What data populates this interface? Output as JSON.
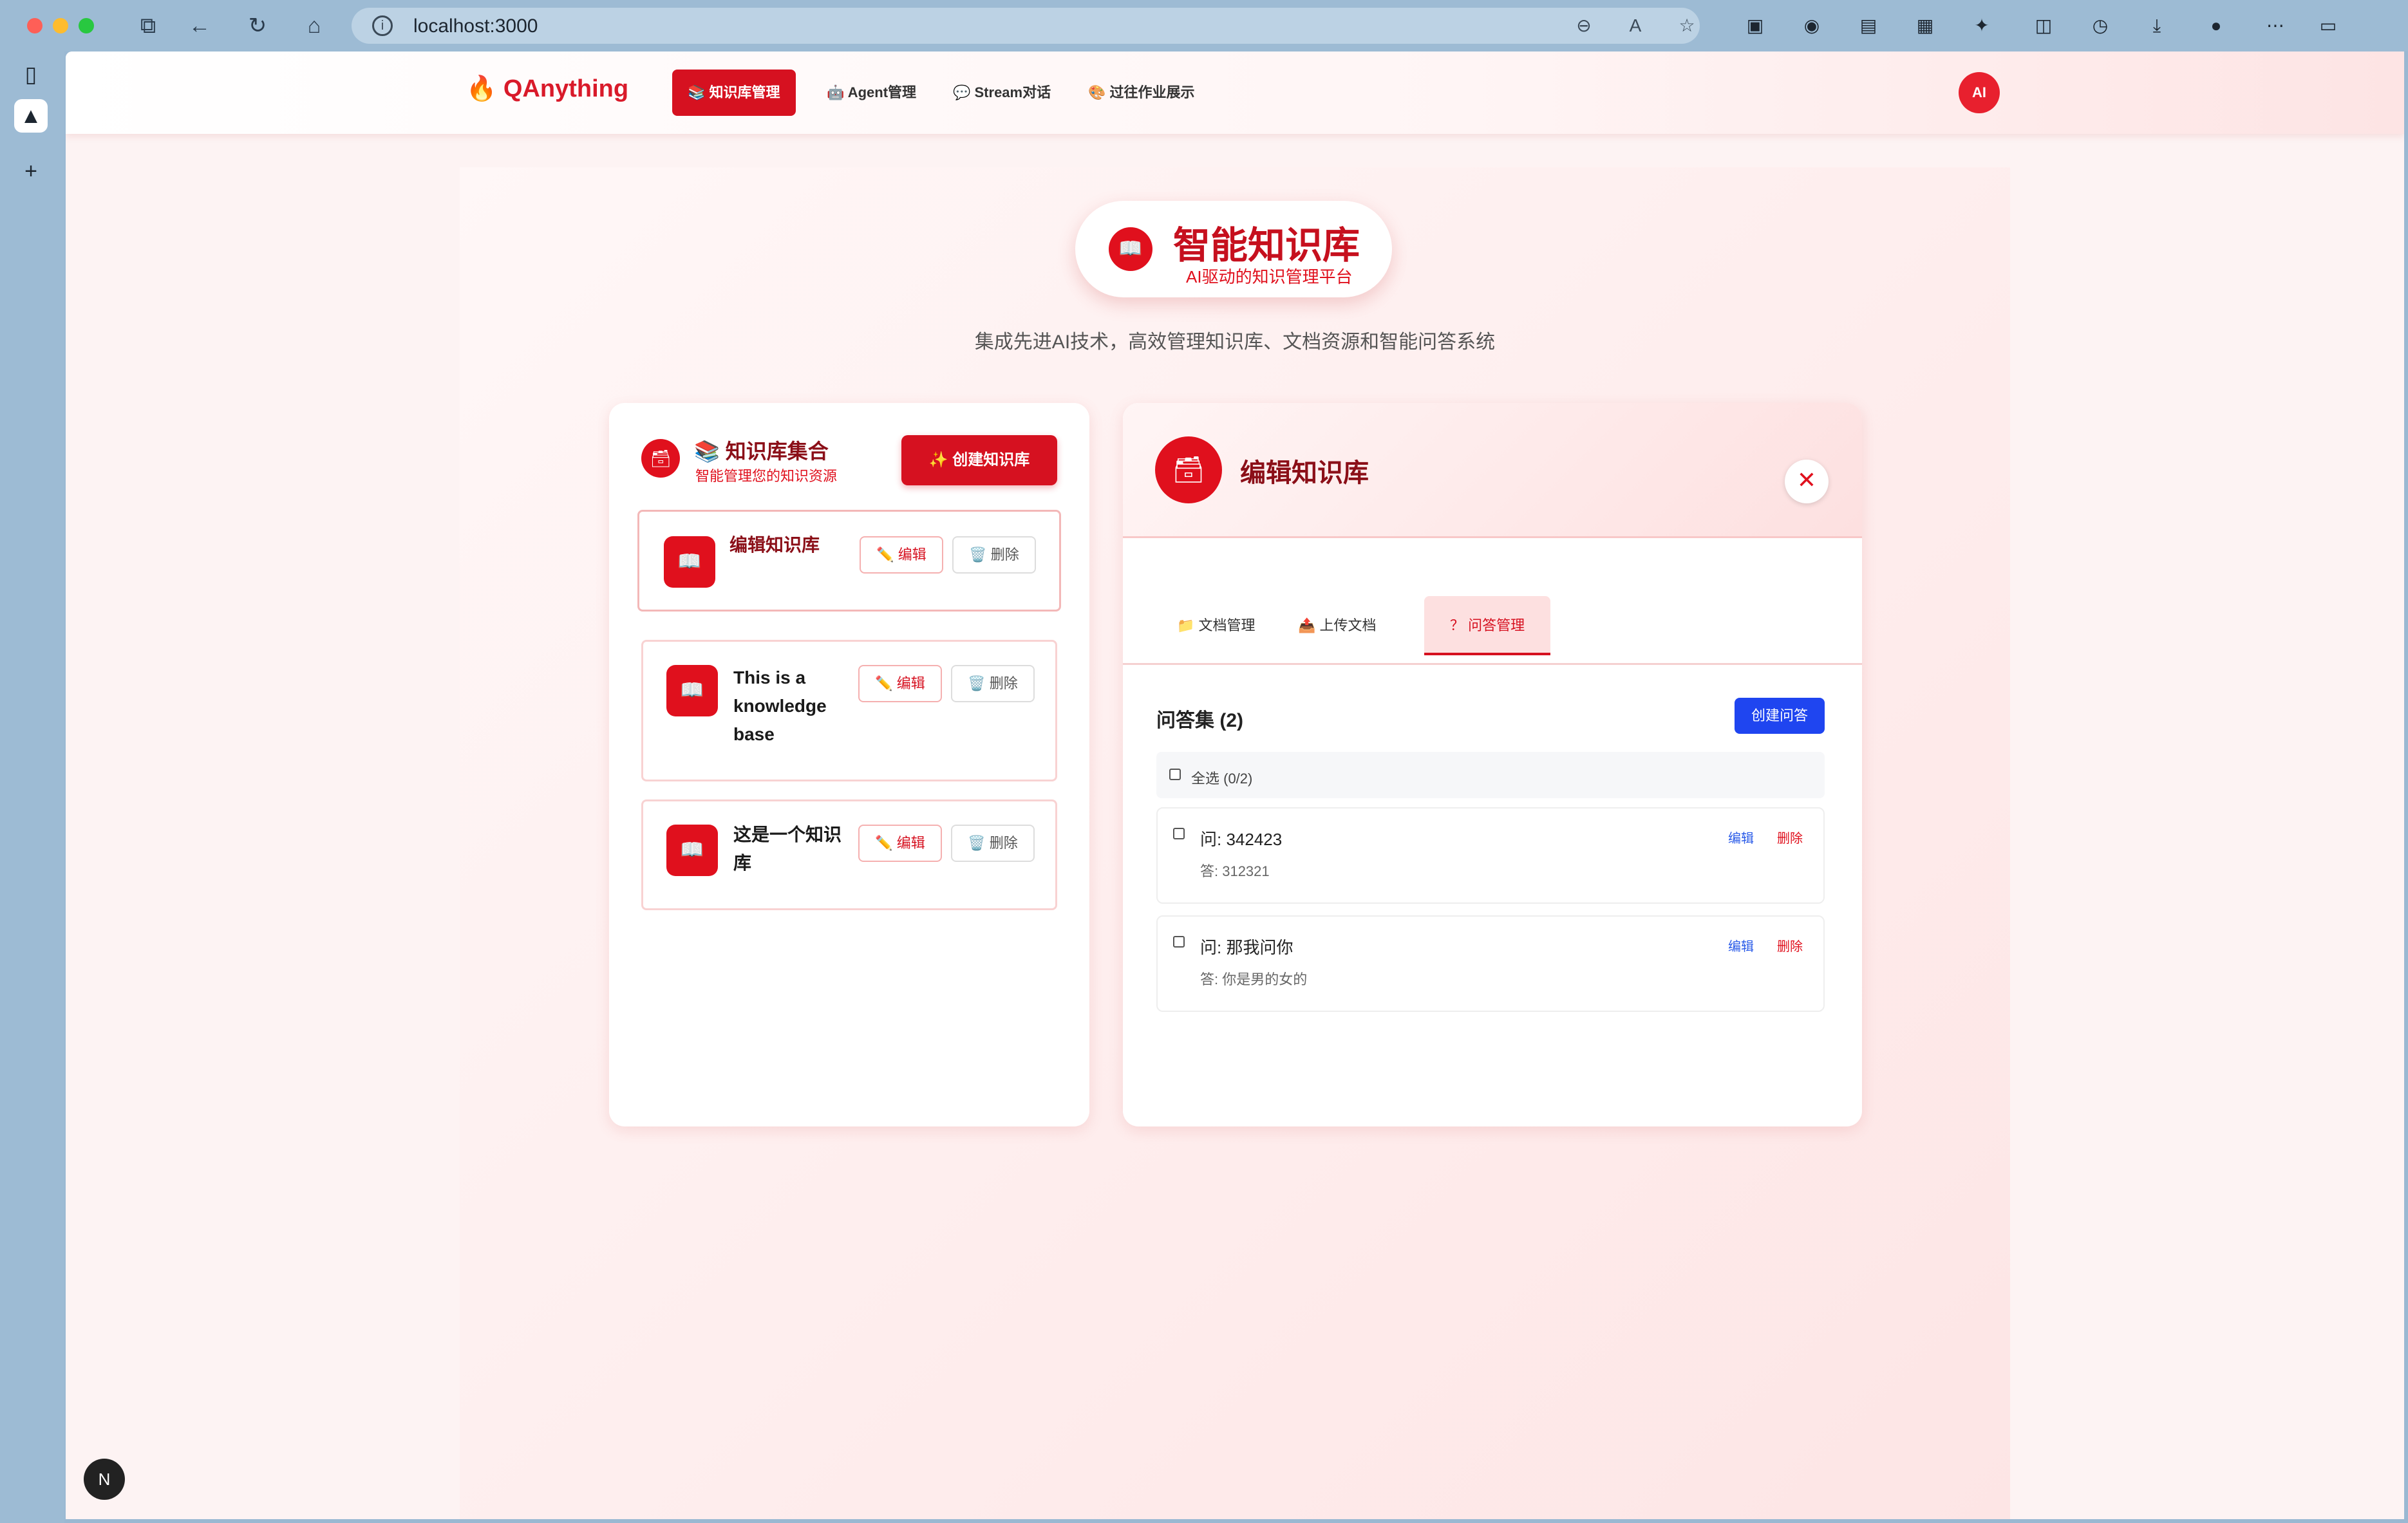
{
  "browser": {
    "url": "localhost:3000"
  },
  "nav": {
    "logo": "🔥 QAnything",
    "items": [
      {
        "label": "📚 知识库管理"
      },
      {
        "label": "🤖 Agent管理"
      },
      {
        "label": "💬 Stream对话"
      },
      {
        "label": "🎨 过往作业展示"
      }
    ],
    "avatar": "AI"
  },
  "hero": {
    "title": "智能知识库",
    "subtitle": "AI驱动的知识管理平台",
    "tagline": "集成先进AI技术，高效管理知识库、文档资源和智能问答系统"
  },
  "kb_panel": {
    "title": "📚 知识库集合",
    "subtitle": "智能管理您的知识资源",
    "create_label": "✨ 创建知识库",
    "items": [
      {
        "name": "编辑知识库",
        "edit": "✏️ 编辑",
        "delete": "🗑️ 删除"
      },
      {
        "name": "This is a knowledge base",
        "edit": "✏️ 编辑",
        "delete": "🗑️ 删除"
      },
      {
        "name": "这是一个知识库",
        "edit": "✏️ 编辑",
        "delete": "🗑️ 删除"
      }
    ]
  },
  "editor": {
    "title": "编辑知识库",
    "tabs": [
      {
        "label": "📁 文档管理"
      },
      {
        "label": "📤 上传文档"
      },
      {
        "label": "？ 问答管理"
      }
    ],
    "qa_title": "问答集 (2)",
    "create_qa": "创建问答",
    "select_all": "全选 (0/2)",
    "qa_items": [
      {
        "q": "问: 342423",
        "a": "答: 312321",
        "edit": "编辑",
        "delete": "删除"
      },
      {
        "q": "问: 那我问你",
        "a": "答: 你是男的女的",
        "edit": "编辑",
        "delete": "删除"
      }
    ]
  },
  "colors": {
    "primary": "#d61120",
    "accent_blue": "#1f45f0"
  }
}
